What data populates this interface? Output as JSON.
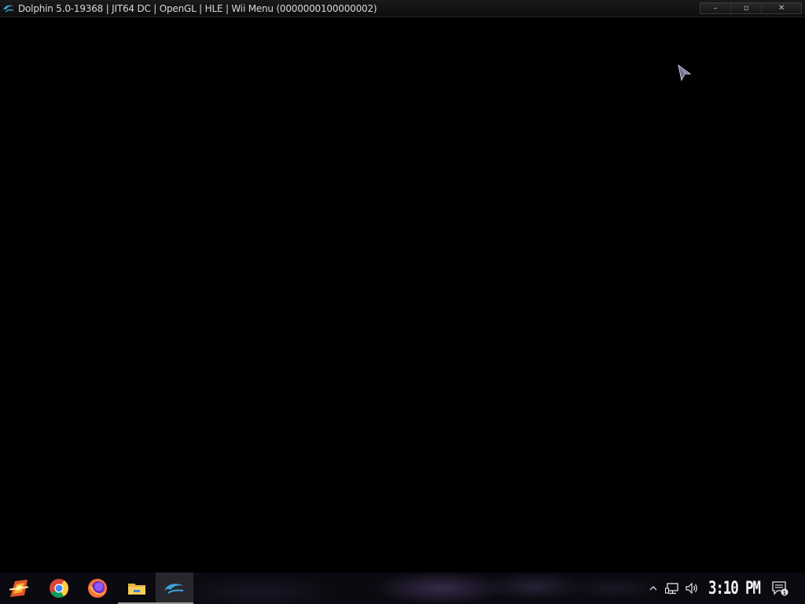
{
  "window": {
    "title": "Dolphin 5.0-19368 | JIT64 DC | OpenGL | HLE | Wii Menu (0000000100000002)",
    "app_icon": "dolphin-icon",
    "controls": {
      "minimize": "–",
      "maximize": "▫",
      "close": "✕"
    }
  },
  "viewport": {
    "background": "#000000",
    "cursor": "wii-pointer-cursor"
  },
  "taskbar": {
    "apps": [
      {
        "name": "start-icon",
        "pinned": true
      },
      {
        "name": "chrome-icon",
        "pinned": true
      },
      {
        "name": "firefox-icon",
        "pinned": true
      },
      {
        "name": "file-explorer-icon",
        "pinned": true,
        "open": true
      },
      {
        "name": "dolphin-icon",
        "pinned": true,
        "open": true,
        "active": true
      }
    ],
    "tray": {
      "overflow_icon": "chevron-up-icon",
      "network_icon": "network-icon",
      "volume_icon": "volume-icon",
      "clock": "3:10 PM",
      "notifications_icon": "action-center-icon",
      "notification_count": "1"
    }
  }
}
